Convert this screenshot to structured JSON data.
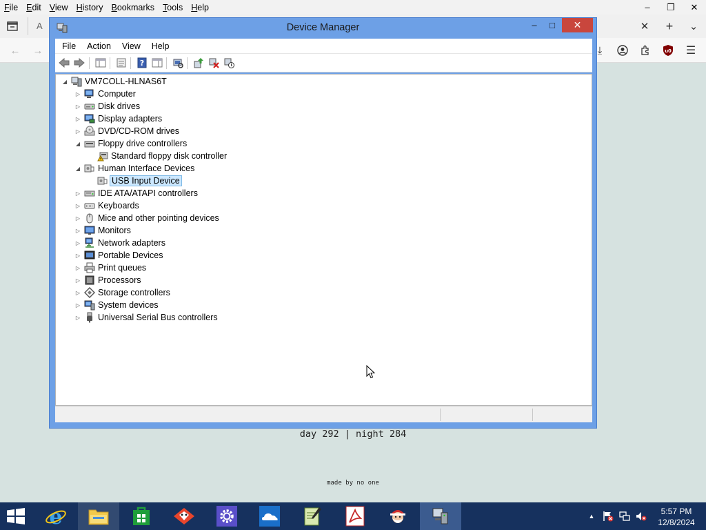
{
  "browser": {
    "menu": [
      {
        "label": "File",
        "ul": "F",
        "rest": "ile"
      },
      {
        "label": "Edit",
        "ul": "E",
        "rest": "dit"
      },
      {
        "label": "View",
        "ul": "V",
        "rest": "iew"
      },
      {
        "label": "History",
        "ul": "H",
        "rest": "istory"
      },
      {
        "label": "Bookmarks",
        "ul": "B",
        "rest": "ookmarks"
      },
      {
        "label": "Tools",
        "ul": "T",
        "rest": "ools"
      },
      {
        "label": "Help",
        "ul": "H",
        "rest": "elp"
      }
    ],
    "tab_letter": "A",
    "background_color": "#d6e2e0"
  },
  "page": {
    "counter_text": "day 292 | night 284",
    "footer_text": "made by no one"
  },
  "device_manager": {
    "title": "Device Manager",
    "menu": [
      "File",
      "Action",
      "View",
      "Help"
    ],
    "toolbar": [
      "back-icon",
      "forward-icon",
      "show-hide-console-tree-icon",
      "properties-icon",
      "help-icon",
      "show-action-pane-icon",
      "scan-hardware-icon",
      "update-driver-icon",
      "uninstall-device-icon",
      "disable-device-icon"
    ],
    "tree": {
      "root": "VM7COLL-HLNAS6T",
      "items": [
        {
          "label": "Computer",
          "expanded": false,
          "icon": "computer-icon"
        },
        {
          "label": "Disk drives",
          "expanded": false,
          "icon": "disk-drive-icon"
        },
        {
          "label": "Display adapters",
          "expanded": false,
          "icon": "display-adapter-icon"
        },
        {
          "label": "DVD/CD-ROM drives",
          "expanded": false,
          "icon": "dvd-drive-icon"
        },
        {
          "label": "Floppy drive controllers",
          "expanded": true,
          "icon": "floppy-controller-icon",
          "children": [
            {
              "label": "Standard floppy disk controller",
              "icon": "floppy-controller-warning-icon",
              "selected": false
            }
          ]
        },
        {
          "label": "Human Interface Devices",
          "expanded": true,
          "icon": "hid-icon",
          "children": [
            {
              "label": "USB Input Device",
              "icon": "hid-device-icon",
              "selected": true
            }
          ]
        },
        {
          "label": "IDE ATA/ATAPI controllers",
          "expanded": false,
          "icon": "ide-controller-icon"
        },
        {
          "label": "Keyboards",
          "expanded": false,
          "icon": "keyboard-icon"
        },
        {
          "label": "Mice and other pointing devices",
          "expanded": false,
          "icon": "mouse-icon"
        },
        {
          "label": "Monitors",
          "expanded": false,
          "icon": "monitor-icon"
        },
        {
          "label": "Network adapters",
          "expanded": false,
          "icon": "network-adapter-icon"
        },
        {
          "label": "Portable Devices",
          "expanded": false,
          "icon": "portable-device-icon"
        },
        {
          "label": "Print queues",
          "expanded": false,
          "icon": "printer-icon"
        },
        {
          "label": "Processors",
          "expanded": false,
          "icon": "processor-icon"
        },
        {
          "label": "Storage controllers",
          "expanded": false,
          "icon": "storage-controller-icon"
        },
        {
          "label": "System devices",
          "expanded": false,
          "icon": "system-device-icon"
        },
        {
          "label": "Universal Serial Bus controllers",
          "expanded": false,
          "icon": "usb-icon"
        }
      ]
    }
  },
  "taskbar": {
    "apps": [
      "file-explorer-icon",
      "internet-explorer-icon",
      "store-icon",
      "fox-app-icon",
      "settings-app-icon",
      "onedrive-icon",
      "notepad-app-icon",
      "pdf-reader-icon",
      "santa-app-icon",
      "device-manager-icon"
    ],
    "clock_time": "5:57 PM",
    "clock_date": "12/8/2024",
    "color": "#16315e"
  }
}
